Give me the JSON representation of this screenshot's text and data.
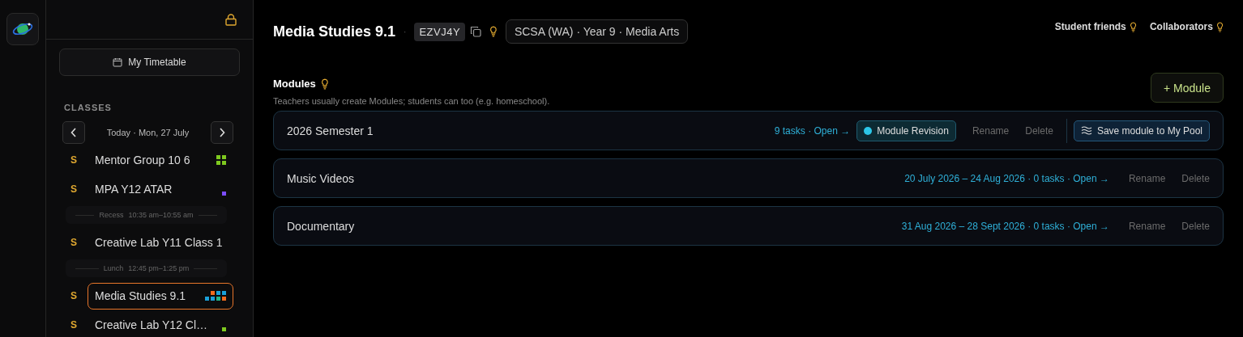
{
  "sidebar": {
    "timetable_button": "My Timetable",
    "section_title": "CLASSES",
    "date_label": "Today · Mon, 27 July",
    "items": [
      {
        "kind": "class",
        "badge": "S",
        "name": "Mentor Group 10 6",
        "selected": false,
        "swatch": {
          "kind": "grid",
          "squares": [
            {
              "color": "#7ec91f"
            },
            {
              "color": "#7ec91f"
            },
            {
              "color": "#7ec91f"
            },
            {
              "color": "#7ec91f"
            }
          ]
        }
      },
      {
        "kind": "class",
        "badge": "S",
        "name": "MPA Y12 ATAR",
        "selected": false,
        "swatch": {
          "kind": "dot",
          "squares": [
            {
              "color": "#7c4dff"
            }
          ]
        }
      },
      {
        "kind": "break",
        "name": "Recess",
        "time": "10:35 am–10:55 am"
      },
      {
        "kind": "class",
        "badge": "S",
        "name": "Creative Lab Y11 Class 1",
        "selected": false
      },
      {
        "kind": "break",
        "name": "Lunch",
        "time": "12:45 pm–1:25 pm"
      },
      {
        "kind": "class",
        "badge": "S",
        "name": "Media Studies 9.1",
        "selected": true,
        "swatch": {
          "kind": "tile",
          "squares": [
            {
              "color": "#f26b1d"
            },
            {
              "color": "#1aa0d8"
            },
            {
              "color": "#1aa0d8"
            },
            {
              "color": "#1aa0d8"
            },
            {
              "color": "#1aa0d8"
            },
            {
              "color": "#1fb58a"
            },
            {
              "color": "#f26b1d"
            }
          ]
        }
      },
      {
        "kind": "class",
        "badge": "S",
        "name": "Creative Lab Y12 Cl…",
        "selected": false,
        "swatch": {
          "kind": "dot",
          "squares": [
            {
              "color": "#7ec91f"
            }
          ]
        }
      }
    ]
  },
  "header": {
    "title": "Media Studies 9.1",
    "separator": "·",
    "code": "EZVJ4Y",
    "curriculum": "SCSA (WA) · Year 9 · Media Arts",
    "links": [
      "Student friends",
      "Collaborators"
    ]
  },
  "modules": {
    "title": "Modules",
    "hint": "Teachers usually create Modules; students can too (e.g. homeschool).",
    "add_button": "+ Module",
    "rows": [
      {
        "name": "2026 Semester 1",
        "meta": "9 tasks · Open →",
        "revision": "Module Revision",
        "rename": "Rename",
        "delete": "Delete",
        "save": "Save module to My Pool"
      },
      {
        "name": "Music Videos",
        "meta": "20 July 2026 – 24 Aug 2026 · 0 tasks · Open →",
        "rename": "Rename",
        "delete": "Delete"
      },
      {
        "name": "Documentary",
        "meta": "31 Aug 2026 – 28 Sept 2026 · 0 tasks · Open →",
        "rename": "Rename",
        "delete": "Delete"
      }
    ]
  }
}
